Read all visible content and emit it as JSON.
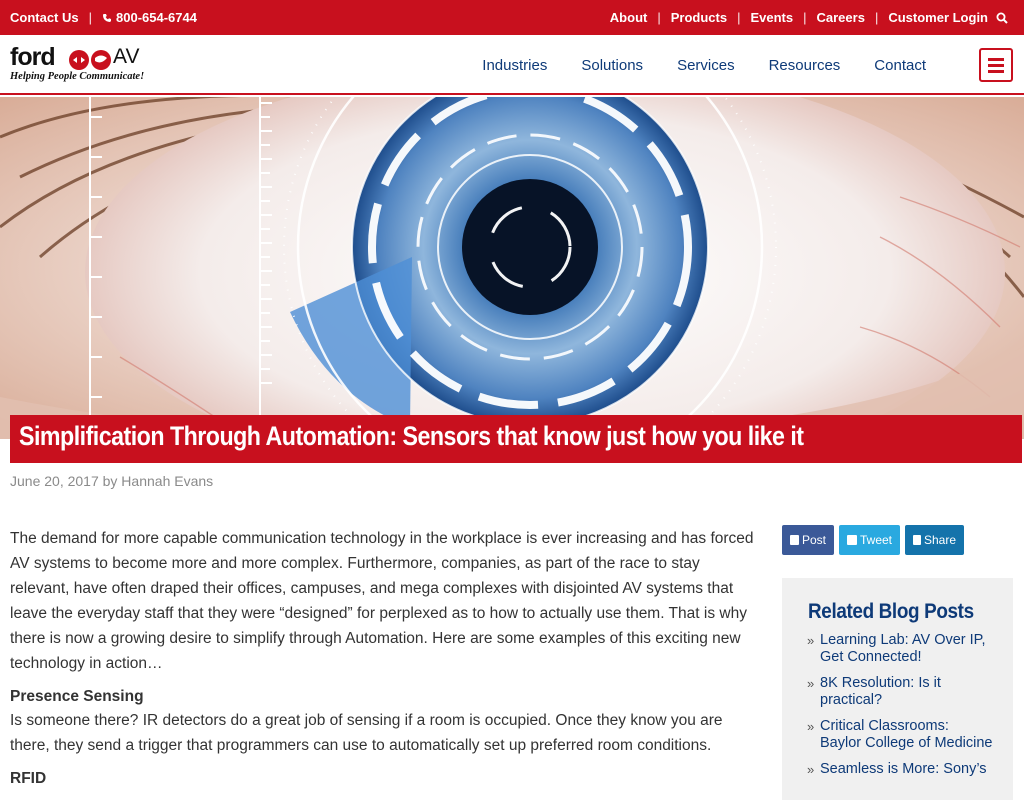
{
  "topbar": {
    "contact": "Contact Us",
    "phone": "800-654-6744",
    "links": [
      "About",
      "Products",
      "Events",
      "Careers",
      "Customer Login"
    ]
  },
  "header": {
    "logo_word": "ford",
    "logo_av": "AV",
    "logo_tagline": "Helping People Communicate!",
    "nav": [
      "Industries",
      "Solutions",
      "Services",
      "Resources",
      "Contact"
    ]
  },
  "post": {
    "title": "Simplification Through Automation: Sensors that know just how you like it",
    "byline": "June 20, 2017 by Hannah Evans",
    "intro": "The demand for more capable communication technology in the workplace is ever increasing and has forced AV systems to become more and more complex. Furthermore, companies, as part of the race to stay relevant, have often draped their offices, campuses, and mega complexes with disjointed AV systems that leave the everyday staff that they were “designed” for perplexed as to how to actually use them. That is why there is now a growing desire to simplify through Automation. Here are some examples of this exciting new technology in action…",
    "section1_heading": "Presence Sensing",
    "section1_text": "Is someone there? IR detectors do a great job of sensing if a room is occupied. Once they know you are there, they send a trigger that programmers can use to automatically set up preferred room conditions.",
    "section2_heading": "RFID"
  },
  "share": {
    "post": "Post",
    "tweet": "Tweet",
    "share": "Share"
  },
  "sidebar": {
    "heading": "Related Blog Posts",
    "items": [
      "Learning Lab: AV Over IP, Get Connected!",
      "8K Resolution: Is it practical?",
      "Critical Classrooms: Baylor College of Medicine",
      "Seamless is More: Sony’s"
    ]
  },
  "colors": {
    "brand_red": "#c8101e",
    "nav_blue": "#0e3a78"
  }
}
